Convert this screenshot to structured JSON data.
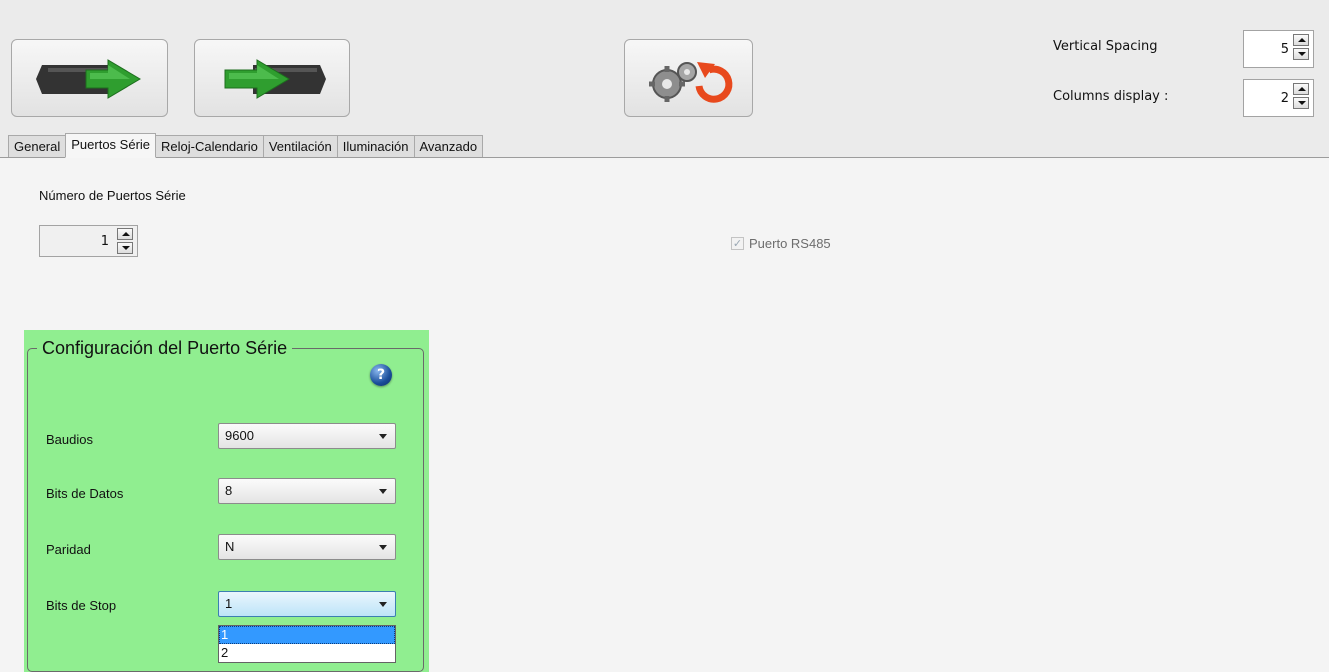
{
  "toolbar": {
    "buttons": [
      {
        "name": "transfer-to-device",
        "icon": "arrow-right-into-device-icon"
      },
      {
        "name": "transfer-from-device",
        "icon": "arrow-right-out-of-device-icon"
      },
      {
        "name": "reset-config",
        "icon": "gears-reset-icon"
      }
    ],
    "vertical_spacing_label": "Vertical Spacing",
    "vertical_spacing_value": "5",
    "columns_display_label": "Columns display :",
    "columns_display_value": "2"
  },
  "tabs": [
    {
      "label": "General",
      "active": false
    },
    {
      "label": "Puertos Série",
      "active": true
    },
    {
      "label": "Reloj-Calendario",
      "active": false
    },
    {
      "label": "Ventilación",
      "active": false
    },
    {
      "label": "Iluminación",
      "active": false
    },
    {
      "label": "Avanzado",
      "active": false
    }
  ],
  "main": {
    "num_ports_label": "Número de Puertos Série",
    "num_ports_value": "1",
    "rs485_label": "Puerto RS485",
    "rs485_checked": true,
    "rs485_enabled": false
  },
  "serial_config": {
    "title": "Configuración del Puerto Série",
    "background": "#90ee90",
    "fields": [
      {
        "label": "Baudios",
        "value": "9600"
      },
      {
        "label": "Bits de Datos",
        "value": "8"
      },
      {
        "label": "Paridad",
        "value": "N"
      },
      {
        "label": "Bits de Stop",
        "value": "1"
      }
    ],
    "stop_bits_options": [
      "1",
      "2"
    ],
    "stop_bits_selected_index": 0
  }
}
